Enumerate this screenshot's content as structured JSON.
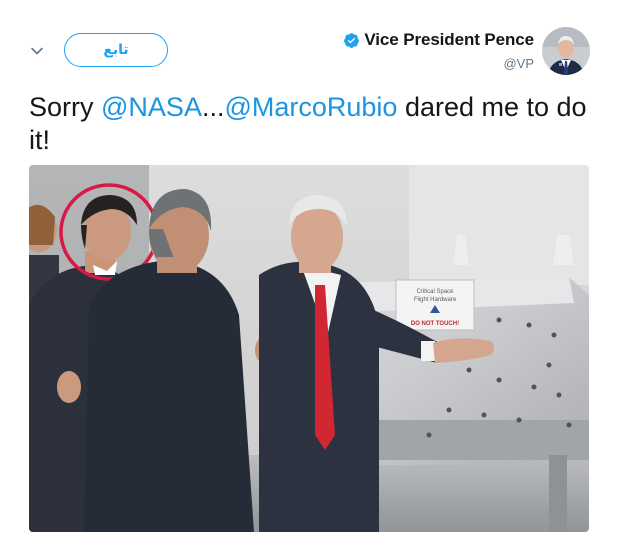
{
  "header": {
    "follow_label": "تابع",
    "display_name": "Vice President Pence",
    "handle": "@VP"
  },
  "icons": {
    "more": "chevron-down-icon",
    "verified": "verified-badge-icon"
  },
  "tweet": {
    "text_before": "Sorry ",
    "mention_1": "@NASA",
    "text_middle": "...",
    "mention_2": "@MarcoRubio",
    "text_after": " dared me to do it!"
  },
  "media": {
    "sign_line_1": "Critical Space",
    "sign_line_2": "Flight Hardware",
    "sign_warning": "DO NOT TOUCH!"
  },
  "colors": {
    "accent": "#1da1f2",
    "mention": "#1b95e0",
    "highlight_circle": "#d3113e"
  }
}
